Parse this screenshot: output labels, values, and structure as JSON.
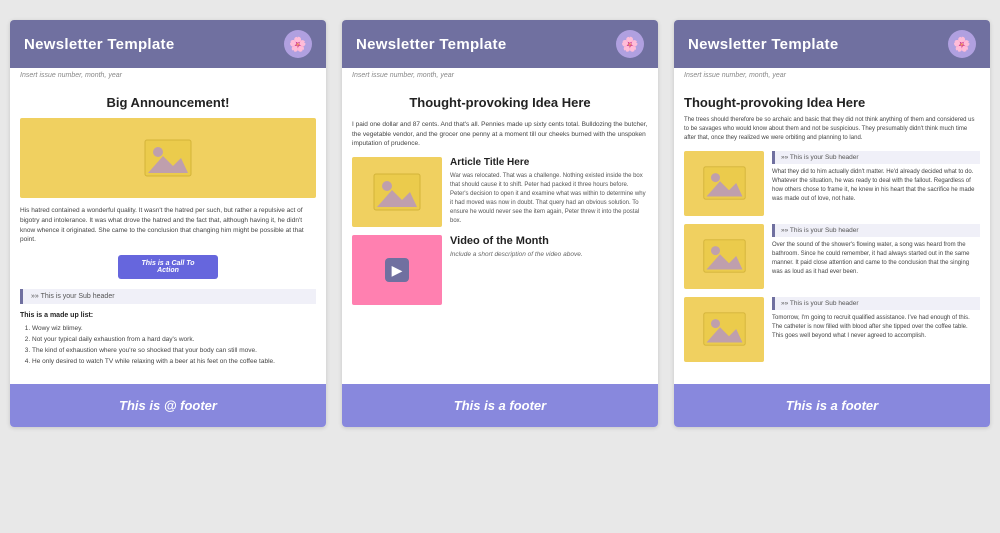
{
  "templates": [
    {
      "id": "template-1",
      "header": {
        "title": "Newsletter Template",
        "icon": "🌸"
      },
      "subheader": "Insert issue number, month, year",
      "big_announcement": "Big Announcement!",
      "main_image_alt": "main image",
      "body_text": "His hatred contained a wonderful quality. It wasn't the hatred per such, but rather a repulsive act of bigotry and intolerance. It was what drove the hatred and the fact that, although having it, he didn't know whence it originated. She came to the conclusion that changing him might be possible at that point.",
      "cta_button": "This is a Call To Action",
      "subheader_box": "This is your Sub header",
      "list_title": "This is a made up list:",
      "list_items": [
        "Wowy wiz blimey.",
        "Not your typical daily exhaustion from a hard day's work.",
        "The kind of exhaustion where you're so shocked that your body can still move.",
        "He only desired to watch TV while relaxing with a beer at his feet on the coffee table."
      ],
      "footer": "This is @ footer"
    },
    {
      "id": "template-2",
      "header": {
        "title": "Newsletter Template",
        "icon": "🌸"
      },
      "subheader": "Insert issue number, month, year",
      "main_title": "Thought-provoking\nIdea Here",
      "body_text": "I paid one dollar and 87 cents. And that's all. Pennies made up sixty cents total. Bulldozing the butcher, the vegetable vendor, and the grocer one penny at a moment till our cheeks burned with the unspoken imputation of prudence.",
      "article_title": "Article Title Here",
      "article_text": "War was relocated. That was a challenge. Nothing existed inside the box that should cause it to shift. Peter had packed it three hours before. Peter's decision to open it and examine what was within to determine why it had moved was now in doubt. That query had an obvious solution. To ensure he would never see the item again, Peter threw it into the postal box.",
      "video_section_title": "Video of the Month",
      "video_description": "Include a short description of the video above.",
      "footer": "This is a footer"
    },
    {
      "id": "template-3",
      "header": {
        "title": "Newsletter Template",
        "icon": "🌸"
      },
      "subheader": "Insert issue number, month, year",
      "main_title": "Thought-provoking Idea Here",
      "intro_text": "The trees should therefore be so archaic and basic that they did not think anything of them and considered us to be savages who would know about them and not be suspicious. They presumably didn't think much time after that, once they realized we were orbiting and planning to land.",
      "sections": [
        {
          "subheader": "This is your Sub header",
          "body": "What they did to him actually didn't matter. He'd already decided what to do. Whatever the situation, he was ready to deal with the fallout. Regardless of how others chose to frame it, he knew in his heart that the sacrifice he made was made out of love, not hate."
        },
        {
          "subheader": "This is your Sub header",
          "body": "Over the sound of the shower's flowing water, a song was heard from the bathroom. Since he could remember, it had always started out in the same manner. It paid close attention and came to the conclusion that the singing was as loud as it had ever been."
        },
        {
          "subheader": "This is your Sub header",
          "body": "Tomorrow, I'm going to recruit qualified assistance. I've had enough of this. The catheter is now filled with blood after she tipped over the coffee table. This goes well beyond what I never agreed to accomplish."
        }
      ],
      "footer": "This is a footer"
    }
  ]
}
